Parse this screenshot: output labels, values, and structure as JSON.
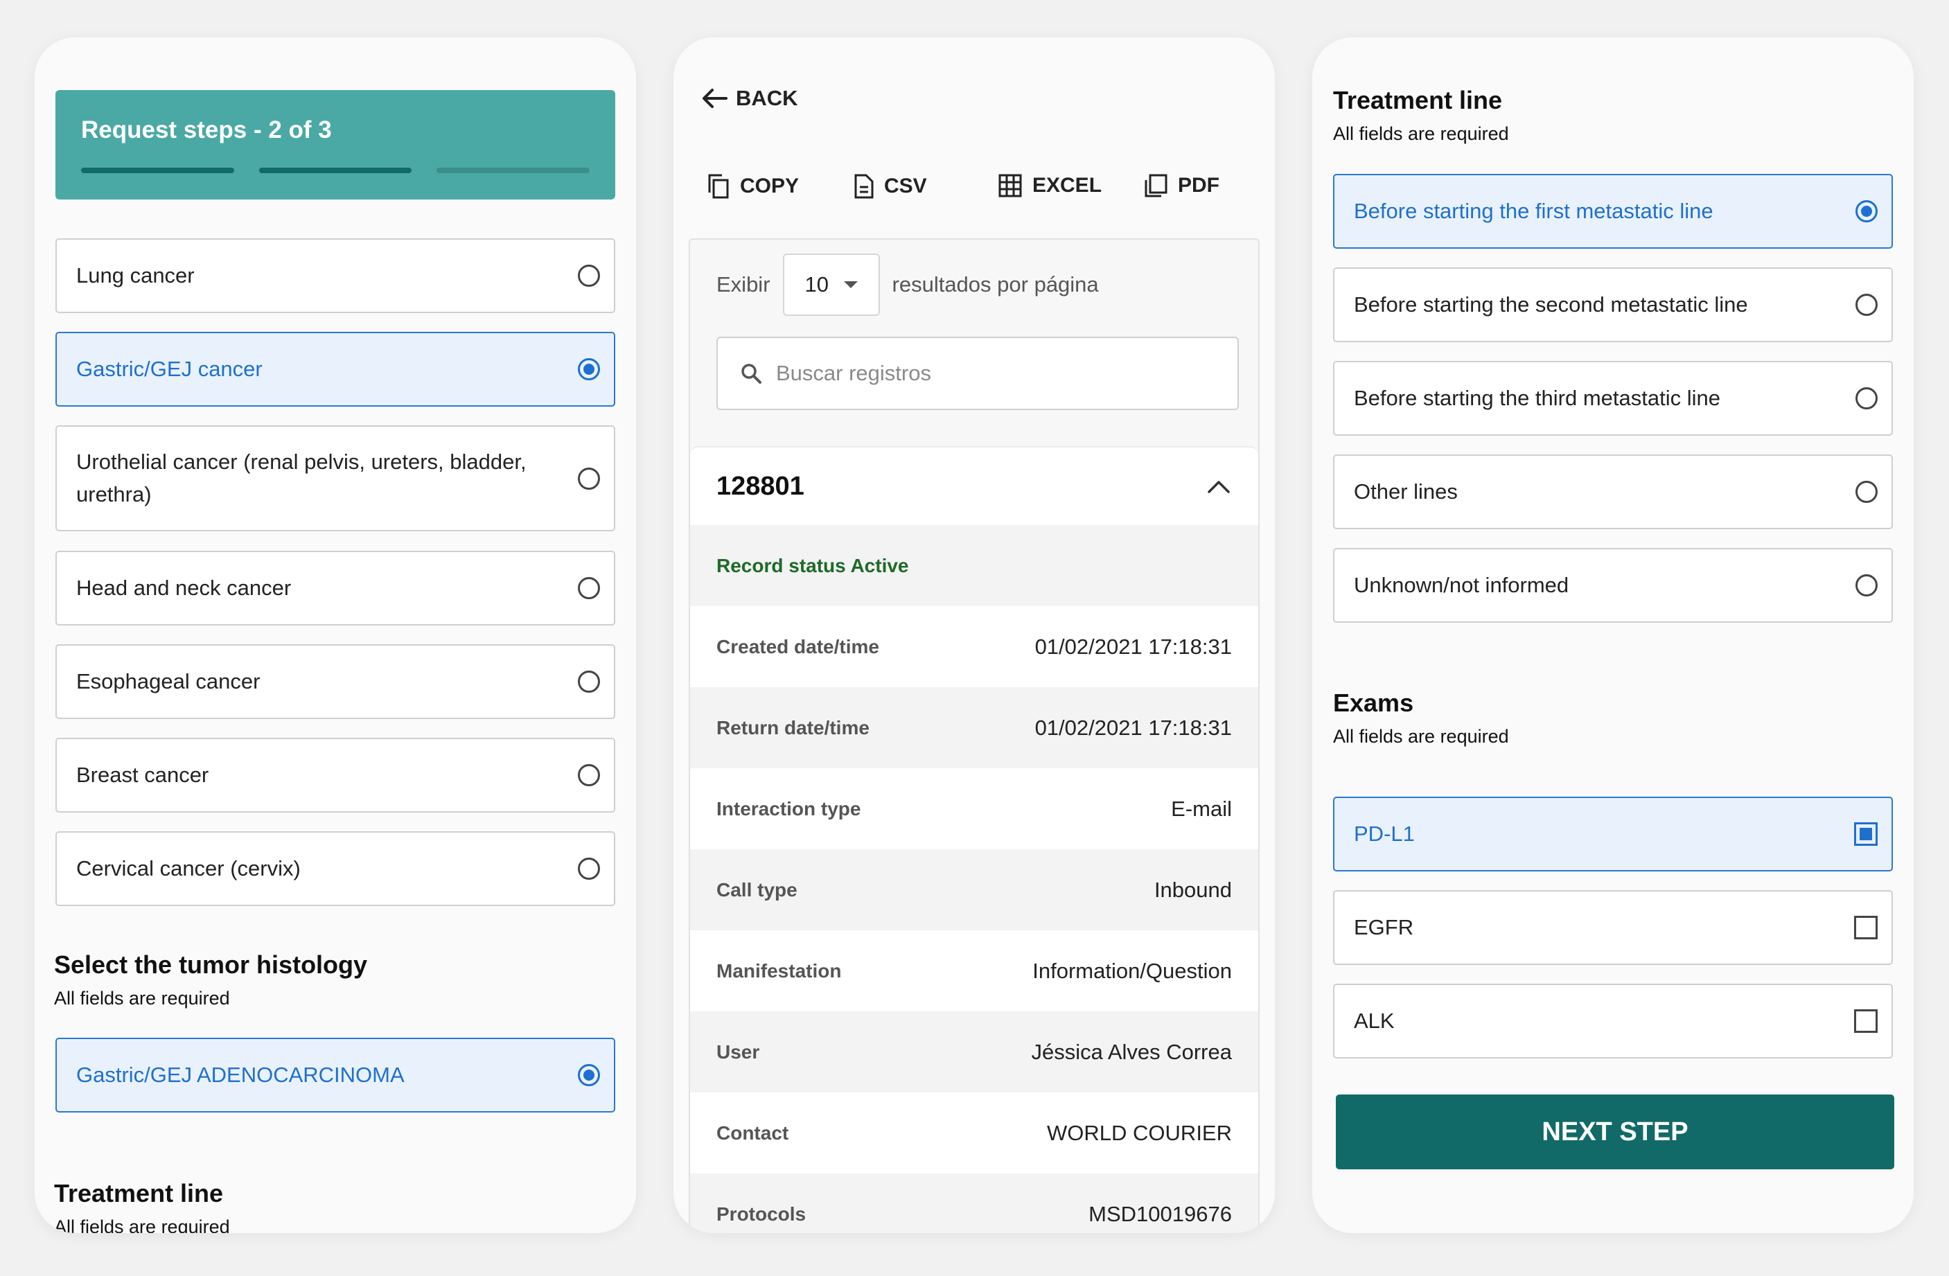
{
  "panel1": {
    "steps_title": "Request steps - 2 of 3",
    "steps": [
      {
        "state": "done"
      },
      {
        "state": "done"
      },
      {
        "state": "todo"
      }
    ],
    "cancer_options": [
      {
        "label": "Lung cancer",
        "selected": false
      },
      {
        "label": "Gastric/GEJ cancer",
        "selected": true
      },
      {
        "label": "Urothelial cancer (renal pelvis, ureters, bladder, urethra)",
        "selected": false
      },
      {
        "label": "Head and neck cancer",
        "selected": false
      },
      {
        "label": "Esophageal cancer",
        "selected": false
      },
      {
        "label": "Breast cancer",
        "selected": false
      },
      {
        "label": "Cervical cancer (cervix)",
        "selected": false
      }
    ],
    "histology_title": "Select the tumor histology",
    "histology_sub": "All fields are required",
    "histology_option": {
      "label": "Gastric/GEJ ADENOCARCINOMA",
      "selected": true
    },
    "treatment_title": "Treatment line",
    "treatment_sub": "All fields are required"
  },
  "panel2": {
    "back_label": "BACK",
    "exports": [
      {
        "label": "COPY",
        "icon": "copy-icon"
      },
      {
        "label": "CSV",
        "icon": "file-icon"
      },
      {
        "label": "EXCEL",
        "icon": "grid-icon"
      },
      {
        "label": "PDF",
        "icon": "pages-icon"
      }
    ],
    "show_label": "Exibir",
    "page_size": "10",
    "per_page_label": "resultados por página",
    "search_placeholder": "Buscar registros",
    "record": {
      "id": "128801",
      "status": "Record status Active",
      "fields": [
        {
          "key": "Created date/time",
          "value": "01/02/2021 17:18:31"
        },
        {
          "key": "Return date/time",
          "value": "01/02/2021 17:18:31"
        },
        {
          "key": "Interaction type",
          "value": "E-mail"
        },
        {
          "key": "Call type",
          "value": "Inbound"
        },
        {
          "key": "Manifestation",
          "value": "Information/Question"
        },
        {
          "key": "User",
          "value": "Jéssica Alves Correa"
        },
        {
          "key": "Contact",
          "value": "WORLD COURIER"
        },
        {
          "key": "Protocols",
          "value": "MSD10019676"
        }
      ]
    }
  },
  "panel3": {
    "treatment_title": "Treatment line",
    "treatment_sub": "All fields are required",
    "treatment_options": [
      {
        "label": "Before starting the first metastatic line",
        "selected": true
      },
      {
        "label": "Before starting the second metastatic line",
        "selected": false
      },
      {
        "label": "Before starting the third metastatic line",
        "selected": false
      },
      {
        "label": "Other lines",
        "selected": false
      },
      {
        "label": "Unknown/not informed",
        "selected": false
      }
    ],
    "exams_title": "Exams",
    "exams_sub": "All fields are required",
    "exam_options": [
      {
        "label": "PD-L1",
        "checked": true
      },
      {
        "label": "EGFR",
        "checked": false
      },
      {
        "label": "ALK",
        "checked": false
      }
    ],
    "next_label": "NEXT STEP"
  },
  "colors": {
    "teal_header": "#4aa9a4",
    "teal_dark": "#116a68",
    "selected_blue": "#1f6fd0",
    "selected_bg": "#e9f2fc",
    "status_green": "#1e6a28"
  }
}
